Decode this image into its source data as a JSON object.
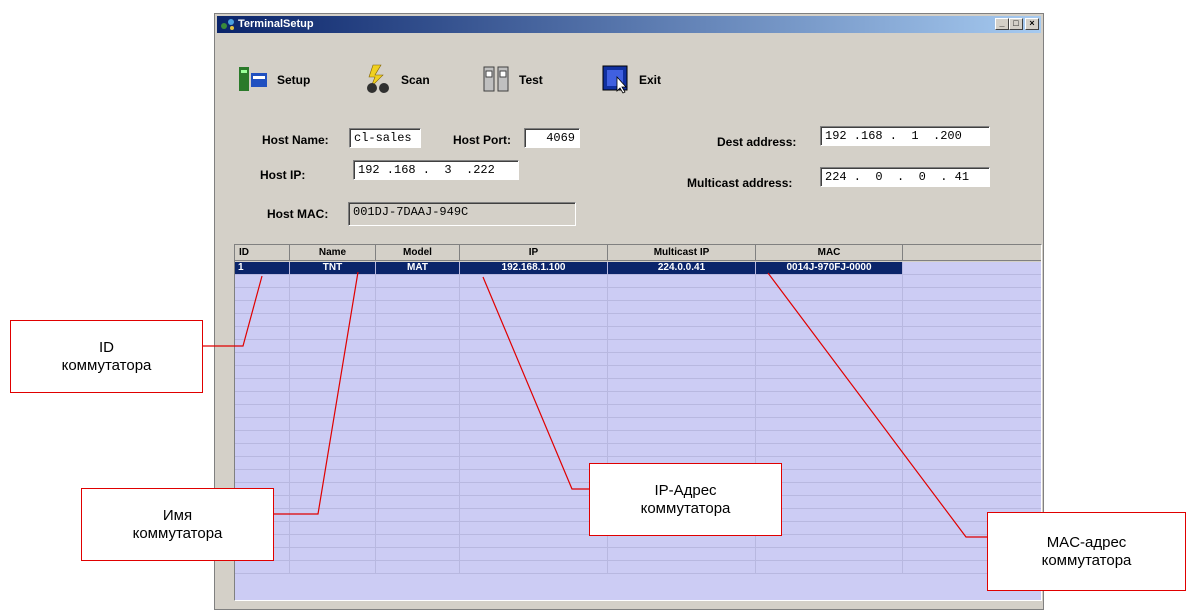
{
  "window": {
    "title": "TerminalSetup"
  },
  "window_controls": {
    "minimize": "_",
    "maximize": "□",
    "close": "×"
  },
  "toolbar": {
    "setup_label": "Setup",
    "scan_label": "Scan",
    "test_label": "Test",
    "exit_label": "Exit"
  },
  "form": {
    "host_name_label": "Host Name:",
    "host_name_value": "cl-sales",
    "host_port_label": "Host Port:",
    "host_port_value": "4069",
    "host_ip_label": "Host IP:",
    "host_ip_value": "192 .168 .  3  .222",
    "host_mac_label": "Host MAC:",
    "host_mac_value": "001DJ-7DAAJ-949C",
    "dest_address_label": "Dest address:",
    "dest_address_value": "192 .168 .  1  .200",
    "multicast_address_label": "Multicast address:",
    "multicast_address_value": "224 .  0  .  0  . 41"
  },
  "table": {
    "columns": [
      "ID",
      "Name",
      "Model",
      "IP",
      "Multicast IP",
      "MAC"
    ],
    "rows": [
      [
        "1",
        "TNT",
        "MAT",
        "192.168.1.100",
        "224.0.0.41",
        "0014J-970FJ-0000"
      ]
    ]
  },
  "callouts": {
    "id": "ID\nкоммутатора",
    "name": "Имя\nкоммутатора",
    "ip": "IP-Адрес\nкоммутатора",
    "mac": "MAC-адрес\nкоммутатора"
  },
  "colors": {
    "titlebar": "#0a246a",
    "grid_bg": "#ccccf4",
    "selection": "#0a246a",
    "callout_line": "#e00000"
  }
}
